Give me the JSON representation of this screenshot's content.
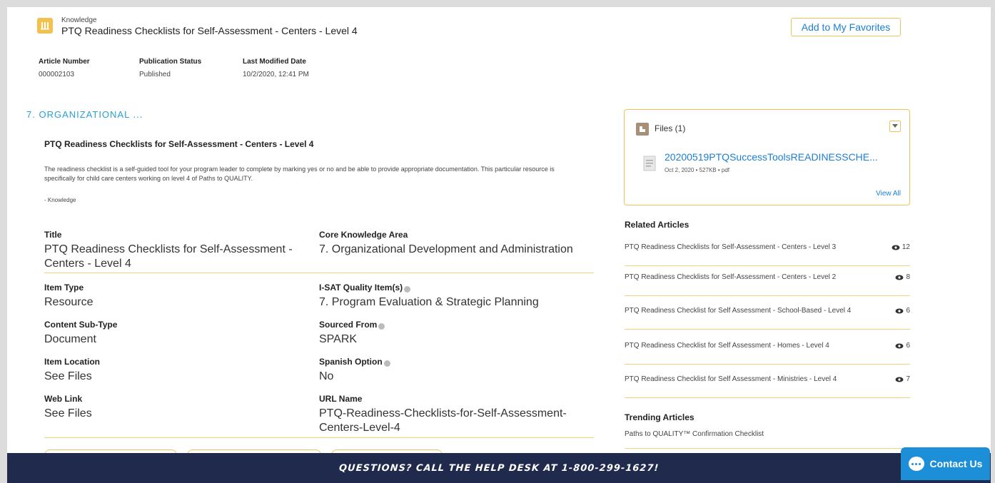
{
  "header": {
    "object_type": "Knowledge",
    "title": "PTQ Readiness Checklists for Self-Assessment - Centers - Level 4",
    "favorites_label": "Add to My Favorites"
  },
  "meta": [
    {
      "label": "Article Number",
      "value": "000002103"
    },
    {
      "label": "Publication Status",
      "value": "Published"
    },
    {
      "label": "Last Modified Date",
      "value": "10/2/2020, 12:41 PM"
    }
  ],
  "section": {
    "title": "7. ORGANIZATIONAL ...",
    "article_title": "PTQ Readiness Checklists for Self-Assessment - Centers - Level 4",
    "description": "The readiness checklist is a self-guided tool for your program leader to complete by marking yes or no and be able to provide appropriate documentation. This particular resource is specifically for child care centers working on level 4 of Paths to QUALITY.",
    "tag": "- Knowledge"
  },
  "fields": {
    "title": {
      "label": "Title",
      "value": "PTQ Readiness Checklists for Self-Assessment - Centers - Level 4"
    },
    "core_area": {
      "label": "Core Knowledge Area",
      "value": "7. Organizational Development and Administration"
    },
    "item_type": {
      "label": "Item Type",
      "value": "Resource"
    },
    "isat": {
      "label": "I-SAT Quality Item(s)",
      "value": "7. Program Evaluation & Strategic Planning"
    },
    "content_sub_type": {
      "label": "Content Sub-Type",
      "value": "Document"
    },
    "sourced_from": {
      "label": "Sourced From",
      "value": "SPARK"
    },
    "item_location": {
      "label": "Item Location",
      "value": "See Files"
    },
    "spanish_option": {
      "label": "Spanish Option",
      "value": "No"
    },
    "web_link": {
      "label": "Web Link",
      "value": "See Files"
    },
    "url_name": {
      "label": "URL Name",
      "value": "PTQ-Readiness-Checklists-for-Self-Assessment-Centers-Level-4"
    }
  },
  "files": {
    "heading": "Files (1)",
    "file_name": "20200519PTQSuccessToolsREADINESSCHE...",
    "file_meta": "Oct 2, 2020 • 527KB • pdf",
    "view_all": "View All"
  },
  "related": {
    "heading": "Related Articles",
    "items": [
      {
        "title": "PTQ Readiness Checklists for Self-Assessment - Centers - Level 3",
        "views": "12"
      },
      {
        "title": "PTQ Readiness Checklists for Self-Assessment - Centers - Level 2",
        "views": "8"
      },
      {
        "title": "PTQ Readiness Checklist for Self Assessment - School-Based - Level 4",
        "views": "6"
      },
      {
        "title": "PTQ Readiness Checklist for Self Assessment - Homes - Level 4",
        "views": "6"
      },
      {
        "title": "PTQ Readiness Checklist for Self Assessment - Ministries - Level 4",
        "views": "7"
      }
    ]
  },
  "trending": {
    "heading": "Trending Articles",
    "items": [
      {
        "title": "Paths to QUALITY™ Confirmation Checklist"
      }
    ]
  },
  "footer": {
    "banner": "QUESTIONS? CALL THE HELP DESK AT 1-800-299-1627!",
    "contact_label": "Contact Us"
  },
  "colors": {
    "accent": "#f0c35a",
    "link": "#1c7fd1",
    "section_title": "#2a9fd6",
    "banner_bg": "#1f2a4d",
    "contact_bg": "#1c8fd8"
  }
}
